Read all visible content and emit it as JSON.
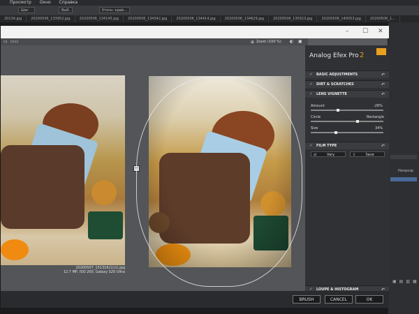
{
  "host": {
    "menu": [
      "Просмотр",
      "Окно",
      "Справка"
    ],
    "options_fields": [
      "Шаг",
      "Выб.",
      "Уточн. край..."
    ],
    "tabs": [
      "20134.jpg",
      "20200506_133952.jpg",
      "20200506_134145.jpg",
      "20200506_134342.jpg",
      "20200506_134414.jpg",
      "20200506_134629.jpg",
      "20200506_135023.jpg",
      "20200506_140053.jpg",
      "20200506_1..."
    ],
    "right_panel_label": "Непрозр"
  },
  "toolbar": {
    "zoom_label": "Zoom (100 %)"
  },
  "preview": {
    "caption_filename": "20200507_151316(1)(1).jpg",
    "caption_details": "12.7 MP, ISO 200, Galaxy S20 Ultra"
  },
  "panel": {
    "brand": "Analog Efex Pro",
    "brand_version": "2",
    "sections": {
      "basic": "BASIC ADJUSTMENTS",
      "dirt": "DIRT & SCRATCHES",
      "vignette": "LENS VIGNETTE",
      "film": "FILM TYPE",
      "loupe": "LOUPE & HISTOGRAM"
    },
    "vignette": {
      "amount_label": "Amount",
      "amount_value": "-26%",
      "amount_fraction": 0.37,
      "circle_label": "Circle",
      "rectangle_label": "Rectangle",
      "shape_fraction": 0.65,
      "size_label": "Size",
      "size_value": "34%",
      "size_fraction": 0.34
    },
    "buttons": {
      "vary": "Vary",
      "save": "Save"
    }
  },
  "footer": {
    "brush": "BRUSH",
    "cancel": "CANCEL",
    "ok": "OK"
  },
  "colors": {
    "accent_orange": "#e8a020",
    "panel_bg": "#303134",
    "dialog_bg": "#5a5b5e"
  }
}
